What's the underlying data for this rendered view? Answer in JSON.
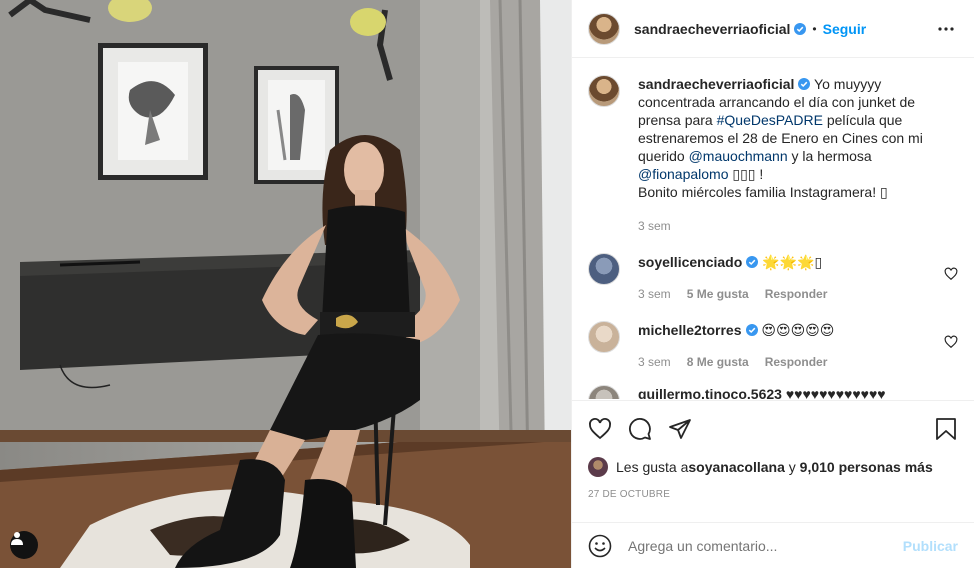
{
  "post": {
    "username": "sandraecheverriaoficial",
    "follow_label": "Seguir",
    "dot": "•"
  },
  "caption": {
    "username": "sandraecheverriaoficial",
    "text_1": " Yo muyyyy concentrada arrancando el día con junket de prensa para ",
    "hashtag": "#QueDesPADRE",
    "text_2": " película que estrenaremos el 28 de Enero en Cines con mi querido ",
    "mention_1": "@mauochmann",
    "text_3": " y la hermosa ",
    "mention_2": "@fionapalomo",
    "text_4": " ▯▯▯ ! ",
    "text_5": "Bonito miércoles familia Instagramera! ▯",
    "time": "3 sem"
  },
  "comments": [
    {
      "username": "soyellicenciado",
      "text": " 🌟🌟🌟▯",
      "time": "3 sem",
      "likes": "5 Me gusta",
      "reply": "Responder"
    },
    {
      "username": "michelle2torres",
      "text": " 😍😍😍😍😍",
      "time": "3 sem",
      "likes": "8 Me gusta",
      "reply": "Responder"
    },
    {
      "username": "guillermo.tinoco.5623",
      "text": " ♥♥♥♥♥♥♥♥♥♥♥♥"
    }
  ],
  "likes": {
    "prefix": "Les gusta a ",
    "user": "soyanacollana",
    "middle": " y ",
    "count": "9,010 personas más"
  },
  "date": "27 DE OCTUBRE",
  "add_comment": {
    "placeholder": "Agrega un comentario...",
    "publish_label": "Publicar"
  },
  "icons": [
    "verified-badge-icon",
    "more-options-icon",
    "heart-icon",
    "comment-icon",
    "share-icon",
    "save-icon",
    "emoji-icon",
    "user-tag-icon"
  ],
  "colors": {
    "accent": "#0095f6",
    "publish_disabled": "#b2dffc",
    "link": "#00376b",
    "muted": "#8e8e8e"
  }
}
